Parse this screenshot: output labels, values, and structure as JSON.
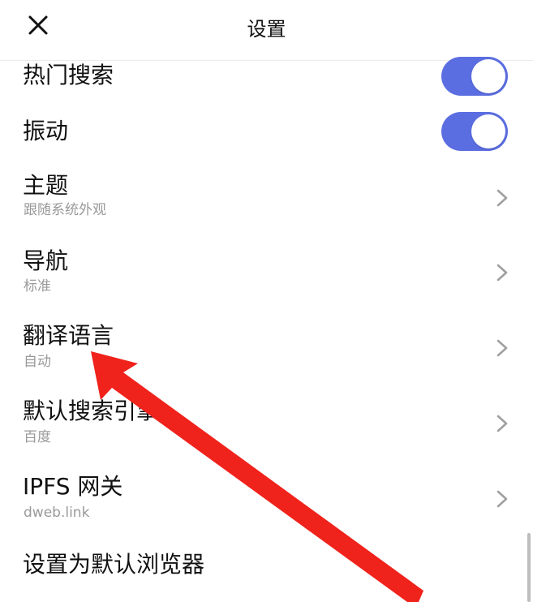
{
  "header": {
    "title": "设置",
    "close_icon": "close-icon"
  },
  "settings": {
    "hot_search": {
      "label": "热门搜索",
      "enabled": true
    },
    "vibration": {
      "label": "振动",
      "enabled": true
    },
    "theme": {
      "label": "主题",
      "value": "跟随系统外观"
    },
    "navigation": {
      "label": "导航",
      "value": "标准"
    },
    "translate_language": {
      "label": "翻译语言",
      "value": "自动"
    },
    "default_search_engine": {
      "label": "默认搜索引擎",
      "value": "百度"
    },
    "ipfs_gateway": {
      "label": "IPFS 网关",
      "value": "dweb.link"
    },
    "set_default_browser": {
      "label": "设置为默认浏览器"
    }
  },
  "colors": {
    "toggle_on": "#5b6ee1",
    "annotation_arrow": "#f0221c",
    "chevron": "#a0a0a0"
  },
  "icons": {
    "close": "close-icon",
    "chevron": "chevron-right-icon",
    "annotation": "arrow-icon"
  }
}
